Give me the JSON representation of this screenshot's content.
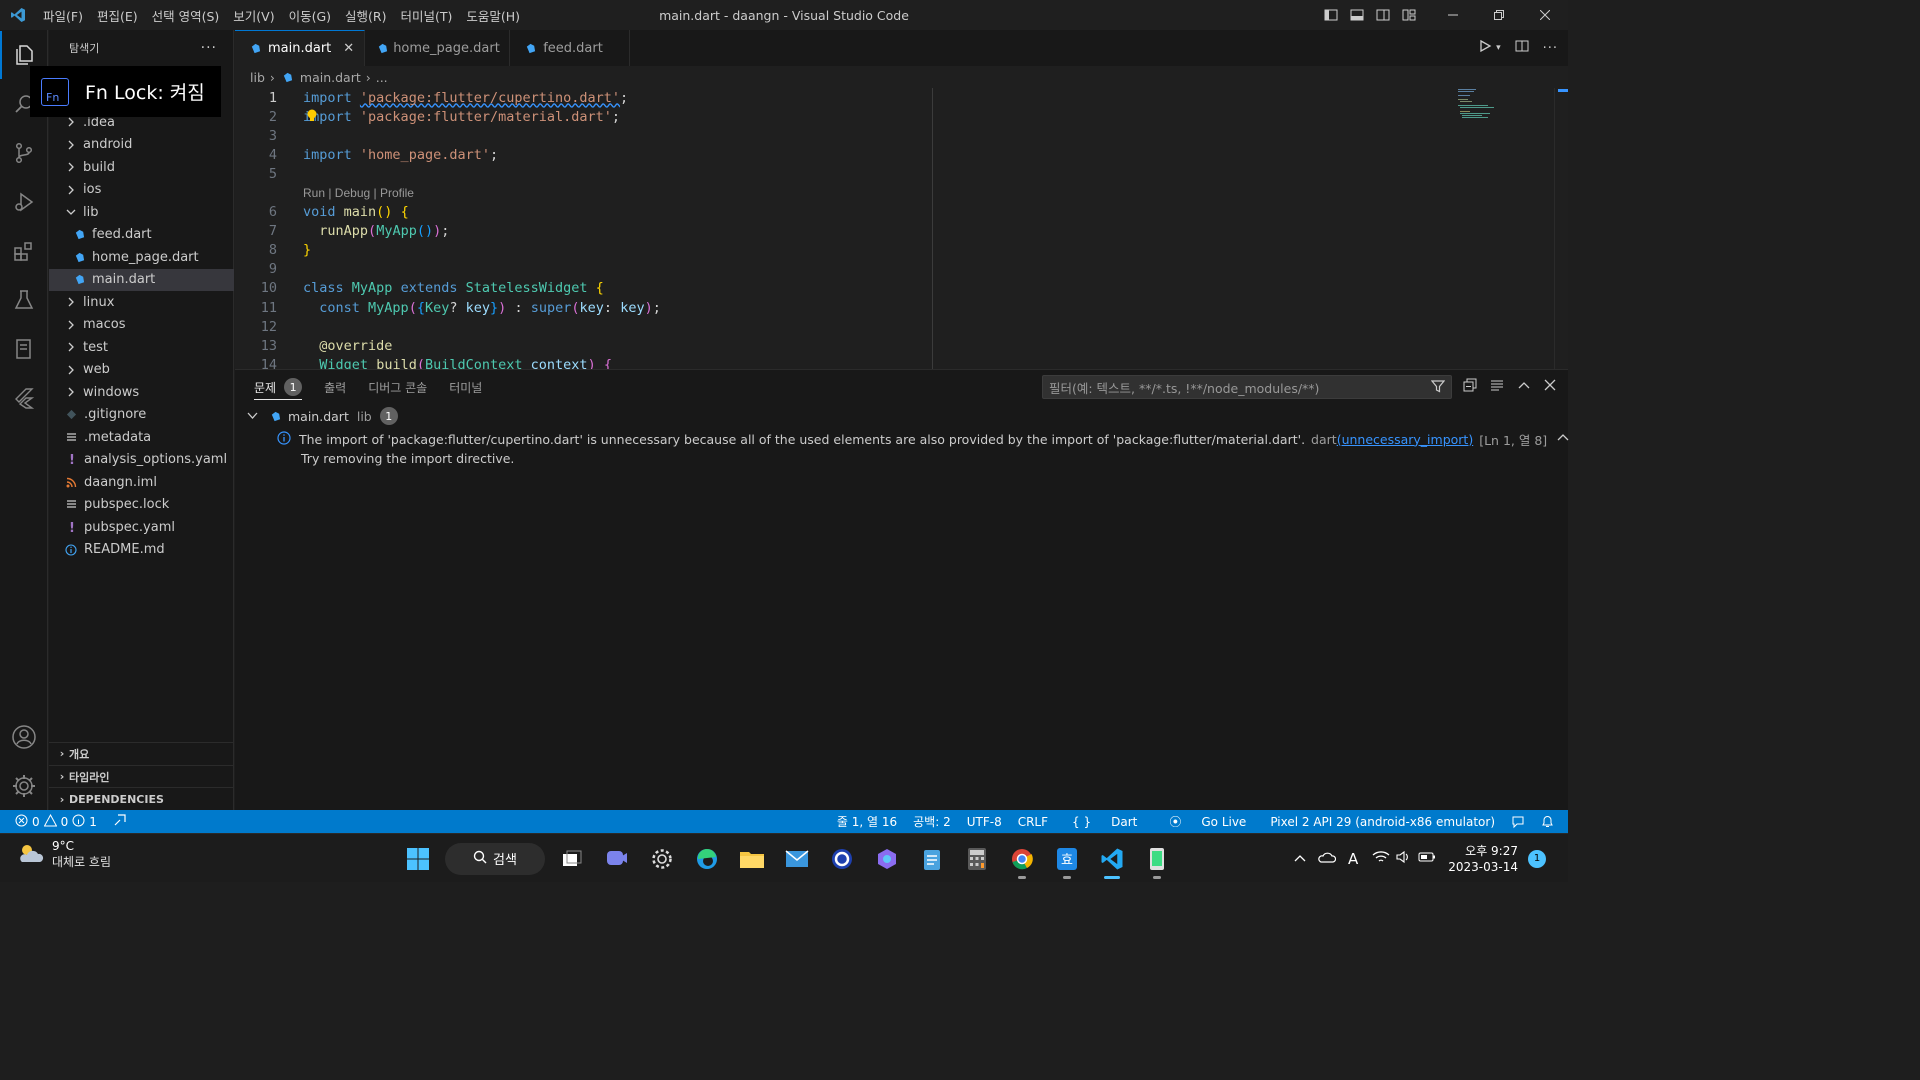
{
  "window": {
    "title": "main.dart - daangn - Visual Studio Code",
    "menu": [
      "파일(F)",
      "편집(E)",
      "선택 영역(S)",
      "보기(V)",
      "이동(G)",
      "실행(R)",
      "터미널(T)",
      "도움말(H)"
    ]
  },
  "fn_lock": {
    "icon_label": "Fn",
    "text": "Fn Lock: 켜짐"
  },
  "sidebar": {
    "title": "탐색기",
    "items": [
      {
        "label": ".idea",
        "type": "folder"
      },
      {
        "label": "android",
        "type": "folder"
      },
      {
        "label": "build",
        "type": "folder"
      },
      {
        "label": "ios",
        "type": "folder"
      },
      {
        "label": "lib",
        "type": "folder-open"
      },
      {
        "label": "feed.dart",
        "type": "dart"
      },
      {
        "label": "home_page.dart",
        "type": "dart"
      },
      {
        "label": "main.dart",
        "type": "dart",
        "selected": true
      },
      {
        "label": "linux",
        "type": "folder"
      },
      {
        "label": "macos",
        "type": "folder"
      },
      {
        "label": "test",
        "type": "folder"
      },
      {
        "label": "web",
        "type": "folder"
      },
      {
        "label": "windows",
        "type": "folder"
      },
      {
        "label": ".gitignore",
        "type": "git"
      },
      {
        "label": ".metadata",
        "type": "lines"
      },
      {
        "label": "analysis_options.yaml",
        "type": "yaml"
      },
      {
        "label": "daangn.iml",
        "type": "rss"
      },
      {
        "label": "pubspec.lock",
        "type": "lines"
      },
      {
        "label": "pubspec.yaml",
        "type": "yaml"
      },
      {
        "label": "README.md",
        "type": "info"
      }
    ],
    "sections": [
      "개요",
      "타임라인",
      "DEPENDENCIES"
    ]
  },
  "tabs": [
    {
      "label": "main.dart",
      "active": true
    },
    {
      "label": "home_page.dart",
      "active": false
    },
    {
      "label": "feed.dart",
      "active": false
    }
  ],
  "breadcrumb": {
    "folder": "lib",
    "file": "main.dart",
    "more": "..."
  },
  "editor": {
    "codelens": "Run | Debug | Profile",
    "line_numbers": [
      "1",
      "2",
      "3",
      "4",
      "5",
      "6",
      "7",
      "8",
      "9",
      "10",
      "11",
      "12",
      "13",
      "14"
    ],
    "lines": {
      "l1": {
        "kw": "import",
        "str": "'package:flutter/cupertino.dart'",
        "end": ";"
      },
      "l2": {
        "kw": "import",
        "str": "'package:flutter/material.dart'",
        "end": ";"
      },
      "l4": {
        "kw": "import",
        "str": "'home_page.dart'",
        "end": ";"
      },
      "l6": {
        "kw": "void",
        "fn": "main",
        "paren": "()",
        "brace": "{"
      },
      "l7": {
        "fn": "runApp",
        "open": "(",
        "cls": "MyApp",
        "inner": "()",
        "close": ")",
        "end": ";"
      },
      "l8": {
        "brace": "}"
      },
      "l10": {
        "kw1": "class",
        "cls1": "MyApp",
        "kw2": "extends",
        "cls2": "StatelessWidget",
        "brace": "{"
      },
      "l11": {
        "kw1": "const",
        "cls1": "MyApp",
        "p1": "(",
        "b1": "{",
        "cls2": "Key",
        "q": "?",
        "var1": "key",
        "b2": "}",
        "p2": ")",
        "colon": ":",
        "kw2": "super",
        "p3": "(",
        "var2": "key",
        "c2": ":",
        "var3": "key",
        "p4": ")",
        "end": ";"
      },
      "l13": {
        "ann": "@override"
      },
      "l14": {
        "cls": "Widget",
        "fn": "build",
        "p": "(",
        "cls2": "BuildContext",
        "var": "context",
        "p2": ")",
        "brace": "{"
      }
    }
  },
  "panel": {
    "tabs": [
      {
        "label": "문제",
        "badge": "1",
        "active": true
      },
      {
        "label": "출력"
      },
      {
        "label": "디버그 콘솔"
      },
      {
        "label": "터미널"
      }
    ],
    "filter_placeholder": "필터(예: 텍스트, **/*.ts, !**/node_modules/**)",
    "problem_file": "main.dart",
    "problem_folder": "lib",
    "problem_count": "1",
    "problem_message": "The import of 'package:flutter/cupertino.dart' is unnecessary because all of the used elements are also provided by the import of 'package:flutter/material.dart'.",
    "problem_source": "dart",
    "problem_code": "(unnecessary_import)",
    "problem_location": "[Ln 1, 열 8]",
    "problem_hint": "Try removing the import directive."
  },
  "statusbar": {
    "errors": "0",
    "warnings": "0",
    "infos": "1",
    "position": "줄 1, 열 16",
    "spaces": "공백: 2",
    "encoding": "UTF-8",
    "eol": "CRLF",
    "language": "Dart",
    "golive": "Go Live",
    "device": "Pixel 2 API 29 (android-x86 emulator)"
  },
  "taskbar": {
    "temp": "9°C",
    "weather": "대체로 흐림",
    "search": "검색",
    "time": "오후 9:27",
    "date": "2023-03-14",
    "notification_count": "1"
  },
  "colors": {
    "accent": "#007acc",
    "dart": "#42a5f5",
    "yaml": "#a074c4",
    "rss": "#e37933"
  }
}
